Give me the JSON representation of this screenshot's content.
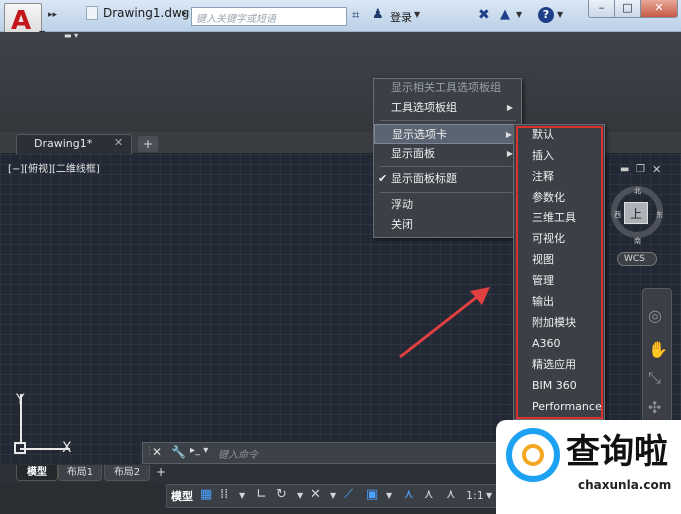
{
  "titlebar": {
    "app_letter": "A",
    "document_title": "Drawing1.dwg",
    "search_placeholder": "键入关键字或短语",
    "login_label": "登录",
    "help_label": "?",
    "min_label": "–",
    "max_label": "□",
    "close_label": "✕"
  },
  "tabs": {
    "document_tab": "Drawing1*",
    "new_tab": "+"
  },
  "viewport": {
    "label": "[−][俯视][二维线框]"
  },
  "ucs": {
    "x_label": "X",
    "y_label": "Y"
  },
  "viewcube": {
    "face": "上",
    "north": "北",
    "south": "南",
    "east": "东",
    "west": "西",
    "wcs": "WCS"
  },
  "command_line": {
    "placeholder": "键入命令"
  },
  "layout_tabs": [
    "模型",
    "布局1",
    "布局2"
  ],
  "status_bar": {
    "model_label": "模型",
    "scale_label": "1:1"
  },
  "context_menu": {
    "items": [
      "显示相关工具选项板组",
      "工具选项板组",
      "显示选项卡",
      "显示面板",
      "显示面板标题",
      "浮动",
      "关闭"
    ]
  },
  "submenu": {
    "items": [
      "默认",
      "插入",
      "注释",
      "参数化",
      "三维工具",
      "可视化",
      "视图",
      "管理",
      "输出",
      "附加模块",
      "A360",
      "精选应用",
      "BIM 360",
      "Performance"
    ]
  },
  "watermark": {
    "text": "查询啦",
    "url": "chaxunla.com"
  },
  "colors": {
    "highlight_border": "#d6332f",
    "canvas_bg": "#222834",
    "arrow": "#e04040"
  }
}
